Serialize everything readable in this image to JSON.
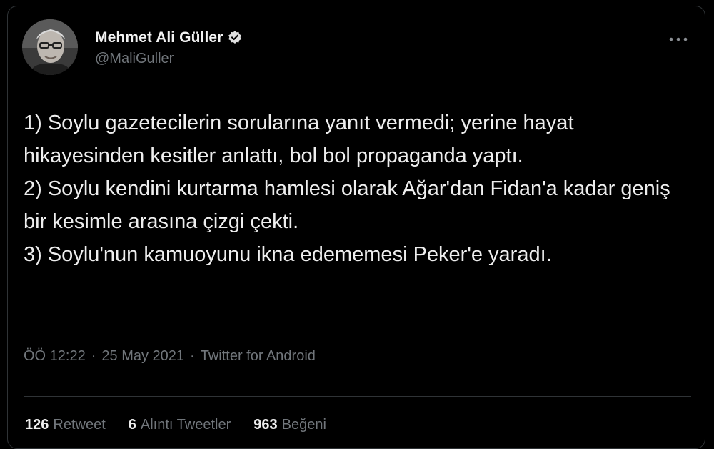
{
  "tweet": {
    "author": {
      "name": "Mehmet Ali Güller",
      "handle": "@MaliGuller",
      "verified": true
    },
    "text": "1) Soylu gazetecilerin sorularına yanıt vermedi; yerine hayat hikayesinden kesitler anlattı, bol bol propaganda yaptı.\n2) Soylu kendini kurtarma hamlesi olarak Ağar'dan Fidan'a kadar geniş bir kesimle arasına çizgi çekti.\n3) Soylu'nun kamuoyunu ikna edememesi Peker'e yaradı.",
    "time": "ÖÖ 12:22",
    "date": "25 May 2021",
    "separator": "·",
    "source": "Twitter for Android",
    "stats": {
      "retweets": {
        "count": "126",
        "label": "Retweet"
      },
      "quotes": {
        "count": "6",
        "label": "Alıntı Tweetler"
      },
      "likes": {
        "count": "963",
        "label": "Beğeni"
      }
    }
  },
  "icons": {
    "verified": "verified-badge-icon",
    "more": "more-options-icon",
    "avatar": "user-photo"
  },
  "colors": {
    "background": "#000000",
    "text": "#e7e9ea",
    "secondary": "#71767b",
    "border": "#2f3336"
  }
}
